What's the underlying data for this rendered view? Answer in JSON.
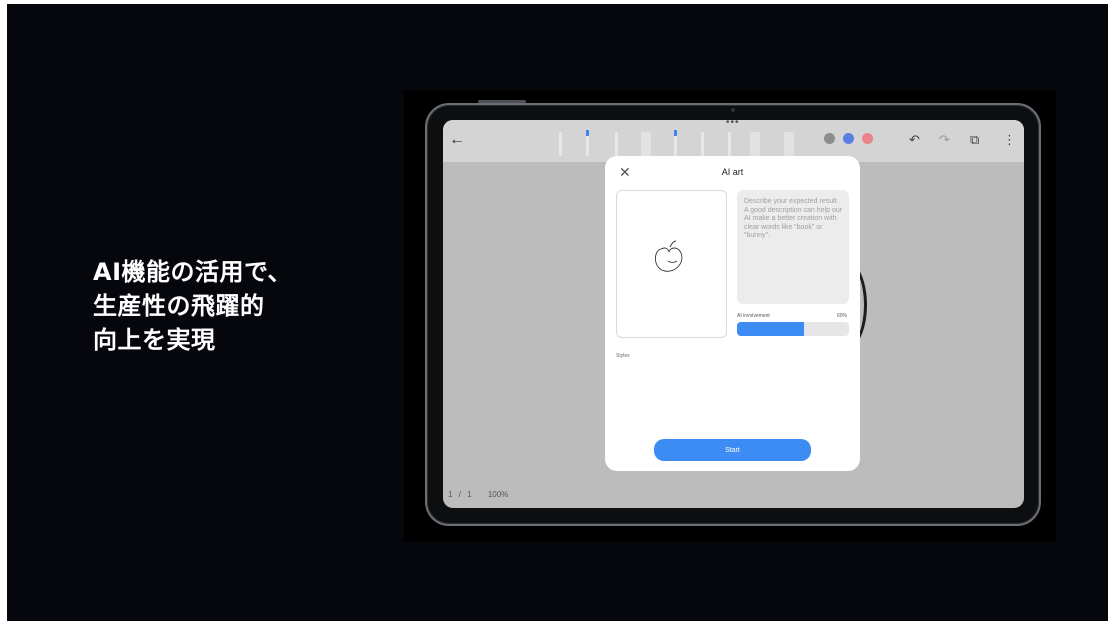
{
  "headline": {
    "line1": "AI機能の活用で、",
    "line2": "生産性の飛躍的",
    "line3": "向上を実現"
  },
  "toolbar": {
    "back_icon": "arrow-left-icon",
    "more_icon": "horizontal-dots-icon",
    "colors": [
      "#8c8c8c",
      "#5a7fe0",
      "#e8848a"
    ],
    "undo_icon": "undo-icon",
    "redo_icon": "redo-icon",
    "share_icon": "share-icon",
    "menu_icon": "vertical-dots-icon"
  },
  "footer": {
    "page": "1 / 1",
    "zoom": "100%"
  },
  "dialog": {
    "title": "AI art",
    "close_icon": "close-icon",
    "prompt_placeholder": "Describe your expected result. A good description can help our AI make a better creation with clear words like \"book\" or \"bunny\".",
    "involvement_label": "AI involvement",
    "involvement_value": "60%",
    "involvement_fraction": 0.6,
    "styles_label": "Styles",
    "start_label": "Start",
    "accent_color": "#3c8cf4"
  }
}
